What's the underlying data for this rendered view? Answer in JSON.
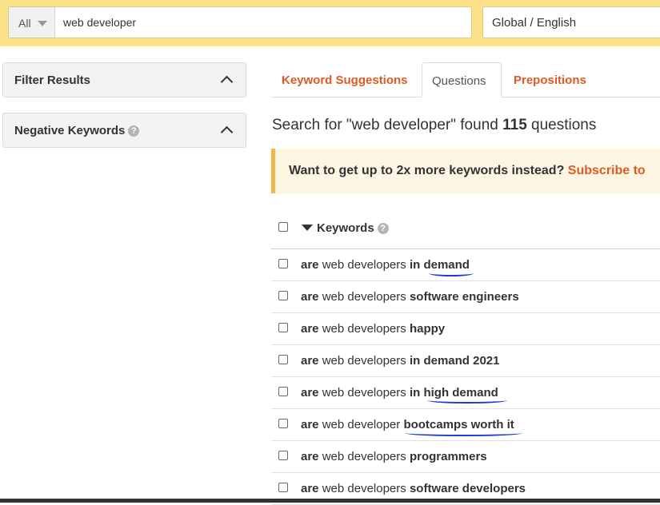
{
  "search": {
    "scope": "All",
    "query": "web developer",
    "region": "Global / English"
  },
  "sidebar": {
    "panels": [
      {
        "label": "Filter Results"
      },
      {
        "label": "Negative Keywords"
      }
    ]
  },
  "tabs": [
    {
      "label": "Keyword Suggestions",
      "active": false
    },
    {
      "label": "Questions",
      "active": true
    },
    {
      "label": "Prepositions",
      "active": false
    }
  ],
  "results": {
    "prefix": "Search for \"web developer\" found ",
    "count": "115",
    "suffix": " questions"
  },
  "banner": {
    "text": "Want to get up to 2x more keywords instead? ",
    "link": "Subscribe to"
  },
  "table": {
    "header": "Keywords",
    "rows": [
      {
        "q": "are",
        "seed": "web developer",
        "mid": "s",
        "rest": " in demand"
      },
      {
        "q": "are",
        "seed": "web developer",
        "mid": "s",
        "rest": " software engineers"
      },
      {
        "q": "are",
        "seed": "web developer",
        "mid": "s",
        "rest": " happy"
      },
      {
        "q": "are",
        "seed": "web developer",
        "mid": "s",
        "rest": " in demand 2021"
      },
      {
        "q": "are",
        "seed": "web developer",
        "mid": "s",
        "rest": " in high demand"
      },
      {
        "q": "are",
        "seed": "web developer",
        "mid": "",
        "rest": " bootcamps worth it"
      },
      {
        "q": "are",
        "seed": "web developer",
        "mid": "s",
        "rest": " programmers"
      },
      {
        "q": "are",
        "seed": "web developer",
        "mid": "s",
        "rest": " software developers"
      }
    ]
  },
  "icons": {
    "help": "question-circle-icon",
    "chevron": "chevron-up-icon"
  },
  "colors": {
    "topbar": "#fce38a",
    "accent": "#e05a23",
    "banner_border": "#f0b64c",
    "annotation": "#1a3cd6"
  }
}
